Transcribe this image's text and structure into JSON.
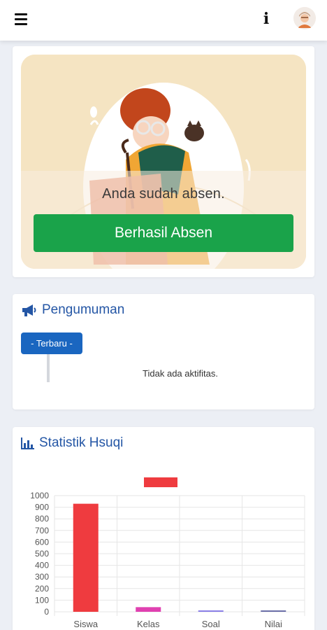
{
  "topbar": {
    "menu_icon": "hamburger-menu-icon",
    "info_icon": "info-icon",
    "avatar_icon": "user-avatar"
  },
  "hero": {
    "message": "Anda sudah absen.",
    "button_label": "Berhasil Absen",
    "colors": {
      "background": "#f5e4c2",
      "button": "#1aa34a"
    }
  },
  "announcement": {
    "title": "Pengumuman",
    "icon": "megaphone-icon",
    "tag": "- Terbaru -",
    "empty_text": "Tidak ada aktifitas."
  },
  "stats": {
    "title": "Statistik Hsuqi",
    "icon": "bar-chart-icon"
  },
  "chart_data": {
    "type": "bar",
    "categories": [
      "Siswa",
      "Kelas",
      "Soal",
      "Nilai"
    ],
    "values": [
      930,
      40,
      12,
      10
    ],
    "bar_colors": [
      "#ef3b3f",
      "#e040b0",
      "#8a7fe6",
      "#6b6fa8"
    ],
    "ylim": [
      0,
      1000
    ],
    "yticks": [
      0,
      100,
      200,
      300,
      400,
      500,
      600,
      700,
      800,
      900,
      1000
    ],
    "legend_swatch_color": "#ef3b3f",
    "grid": true,
    "title": "",
    "xlabel": "",
    "ylabel": ""
  }
}
